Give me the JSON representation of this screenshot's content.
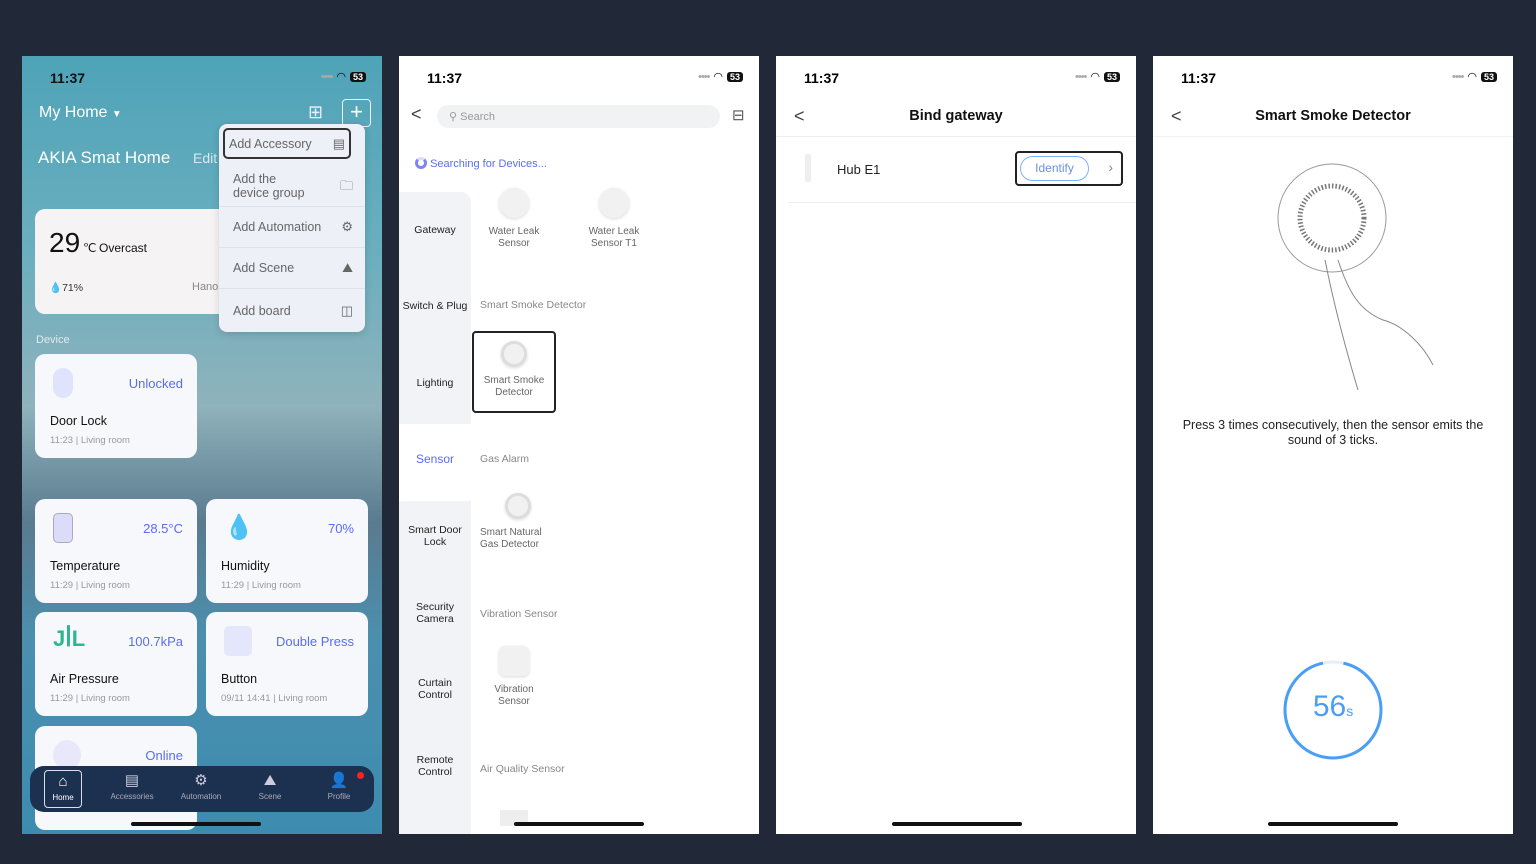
{
  "status": {
    "time": "11:37",
    "battery": "53"
  },
  "home": {
    "home_name": "My Home",
    "title": "AKIA Smat Home",
    "edit": "Edit",
    "weather": {
      "temp": "29",
      "unit": "℃",
      "condition": "Overcast",
      "humidity": "71%",
      "city": "Hano"
    },
    "section": "Device",
    "menu": [
      {
        "label": "Add Accessory",
        "icon": "accessory-icon"
      },
      {
        "label": "Add the device group",
        "icon": "folder-icon"
      },
      {
        "label": "Add Automation",
        "icon": "automation-icon"
      },
      {
        "label": "Add Scene",
        "icon": "scene-icon"
      },
      {
        "label": "Add board",
        "icon": "board-icon"
      }
    ],
    "cards": [
      {
        "name": "Door Lock",
        "value": "Unlocked",
        "sub": "11:23 | Living room"
      },
      {
        "name": "Temperature",
        "value": "28.5°C",
        "sub": "11:29 | Living room"
      },
      {
        "name": "Humidity",
        "value": "70%",
        "sub": "11:29 | Living room"
      },
      {
        "name": "Air Pressure",
        "value": "100.7kPa",
        "sub": "11:29 | Living room"
      },
      {
        "name": "Button",
        "value": "Double Press",
        "sub": "09/11 14:41 | Living room"
      },
      {
        "name": "",
        "value": "Online",
        "sub": ""
      }
    ],
    "tabs": [
      "Home",
      "Accessories",
      "Automation",
      "Scene",
      "Profile"
    ],
    "accent": "#5a6cf0"
  },
  "add": {
    "search_placeholder": "Search",
    "searching": "Searching for Devices...",
    "categories": [
      "Gateway",
      "Switch & Plug",
      "Lighting",
      "Sensor",
      "Smart Door Lock",
      "Security Camera",
      "Curtain Control",
      "Remote Control"
    ],
    "selected_category": "Sensor",
    "groups": {
      "top": [
        "Water Leak Sensor",
        "Water Leak Sensor T1"
      ],
      "smoke_h": "Smart Smoke Detector",
      "smoke": "Smart Smoke Detector",
      "gas_h": "Gas Alarm",
      "gas": "Smart Natural Gas Detector",
      "vib_h": "Vibration Sensor",
      "vib": "Vibration Sensor",
      "air_h": "Air Quality Sensor"
    }
  },
  "bind": {
    "title": "Bind gateway",
    "hub": "Hub E1",
    "identify": "Identify"
  },
  "smoke": {
    "title": "Smart Smoke Detector",
    "instruction": "Press 3 times consecutively, then the sensor emits the sound of 3 ticks.",
    "countdown": "56",
    "unit": "s",
    "progress": 0.93,
    "ring_color": "#4a9ef5"
  }
}
